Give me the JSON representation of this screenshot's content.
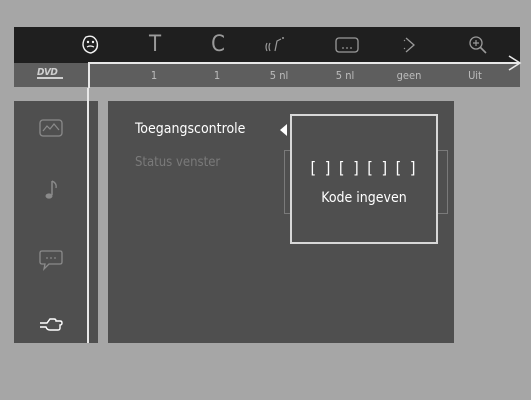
{
  "topbar": {
    "icons": [
      {
        "name": "angle-icon",
        "glyph": "☹",
        "active": true
      },
      {
        "name": "title-icon",
        "glyph": "T",
        "active": false
      },
      {
        "name": "chapter-icon",
        "glyph": "C",
        "active": false
      },
      {
        "name": "audio-icon",
        "glyph": "((•",
        "active": false
      },
      {
        "name": "subtitle-icon",
        "glyph": "…",
        "active": false
      },
      {
        "name": "next-icon",
        "glyph": "›",
        "active": false
      },
      {
        "name": "zoom-icon",
        "glyph": "⊕",
        "active": false
      }
    ],
    "disc_label": "DVD",
    "values": [
      "1",
      "1",
      "5 nl",
      "5 nl",
      "geen",
      "Uit"
    ]
  },
  "sidebar": {
    "icons": [
      {
        "name": "picture-icon",
        "active": false
      },
      {
        "name": "music-note-icon",
        "active": false
      },
      {
        "name": "speech-bubble-icon",
        "active": false
      },
      {
        "name": "hand-icon",
        "active": true
      }
    ]
  },
  "menu": {
    "items": [
      {
        "label": "Toegangscontrole",
        "active": true
      },
      {
        "label": "Status venster",
        "active": false
      }
    ]
  },
  "dialog": {
    "code_slots": "[ ] [ ] [ ] [ ]",
    "label": "Kode ingeven"
  }
}
